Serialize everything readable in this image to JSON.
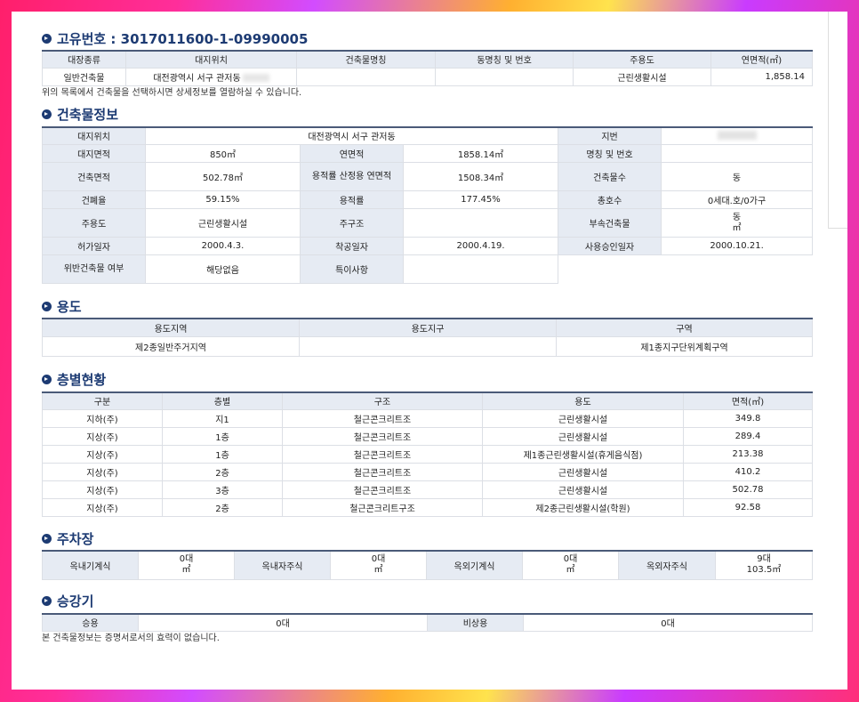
{
  "header": {
    "title": "고유번호 : 3017011600-1-09990005"
  },
  "list_table": {
    "headers": [
      "대장종류",
      "대지위치",
      "건축물명칭",
      "동명칭 및 번호",
      "주용도",
      "연면적(㎡)"
    ],
    "row": [
      "일반건축물",
      "대전광역시 서구 관저동",
      "",
      "",
      "근린생활시설",
      "1,858.14"
    ]
  },
  "list_note": "위의 목록에서 건축물을 선택하시면 상세정보를 열람하실 수 있습니다.",
  "building": {
    "title": "건축물정보",
    "labels": {
      "site_loc": "대지위치",
      "lot": "지번",
      "site_area": "대지면적",
      "total_area": "연면적",
      "name": "명칭 및 번호",
      "build_area": "건축면적",
      "far_area": "용적률 산정용 연면적",
      "floors": "건축물수",
      "bcr": "건폐율",
      "far": "용적률",
      "households": "총호수",
      "main_use": "주용도",
      "structure": "주구조",
      "annex": "부속건축물",
      "permit": "허가일자",
      "start": "착공일자",
      "approval": "사용승인일자",
      "violation": "위반건축물 여부",
      "remarks": "특이사항"
    },
    "values": {
      "site_loc": "대전광역시 서구 관저동",
      "site_area": "850㎡",
      "total_area": "1858.14㎡",
      "name": "",
      "build_area": "502.78㎡",
      "far_area": "1508.34㎡",
      "floors": "동",
      "bcr": "59.15%",
      "far": "177.45%",
      "households": "0세대.호/0가구",
      "main_use": "근린생활시설",
      "structure": "",
      "annex_1": "동",
      "annex_2": "㎡",
      "permit": "2000.4.3.",
      "start": "2000.4.19.",
      "approval": "2000.10.21.",
      "violation": "해당없음",
      "remarks": ""
    }
  },
  "usage": {
    "title": "용도",
    "headers": [
      "용도지역",
      "용도지구",
      "구역"
    ],
    "row": [
      "제2종일반주거지역",
      "",
      "제1종지구단위계획구역"
    ]
  },
  "floors": {
    "title": "층별현황",
    "headers": [
      "구분",
      "층별",
      "구조",
      "용도",
      "면적(㎡)"
    ],
    "rows": [
      [
        "지하(주)",
        "지1",
        "철근콘크리트조",
        "근린생활시설",
        "349.8"
      ],
      [
        "지상(주)",
        "1층",
        "철근콘크리트조",
        "근린생활시설",
        "289.4"
      ],
      [
        "지상(주)",
        "1층",
        "철근콘크리트조",
        "제1종근린생활시설(휴게음식점)",
        "213.38"
      ],
      [
        "지상(주)",
        "2층",
        "철근콘크리트조",
        "근린생활시설",
        "410.2"
      ],
      [
        "지상(주)",
        "3층",
        "철근콘크리트조",
        "근린생활시설",
        "502.78"
      ],
      [
        "지상(주)",
        "2층",
        "철근콘크리트구조",
        "제2종근린생활시설(학원)",
        "92.58"
      ]
    ]
  },
  "parking": {
    "title": "주차장",
    "labels": [
      "옥내기계식",
      "옥내자주식",
      "옥외기계식",
      "옥외자주식"
    ],
    "values": [
      [
        "0대",
        "㎡"
      ],
      [
        "0대",
        "㎡"
      ],
      [
        "0대",
        "㎡"
      ],
      [
        "9대",
        "103.5㎡"
      ]
    ]
  },
  "elevator": {
    "title": "승강기",
    "labels": [
      "승용",
      "비상용"
    ],
    "values": [
      "0대",
      "0대"
    ]
  },
  "footer_note": "본 건축물정보는 증명서로서의 효력이 없습니다."
}
